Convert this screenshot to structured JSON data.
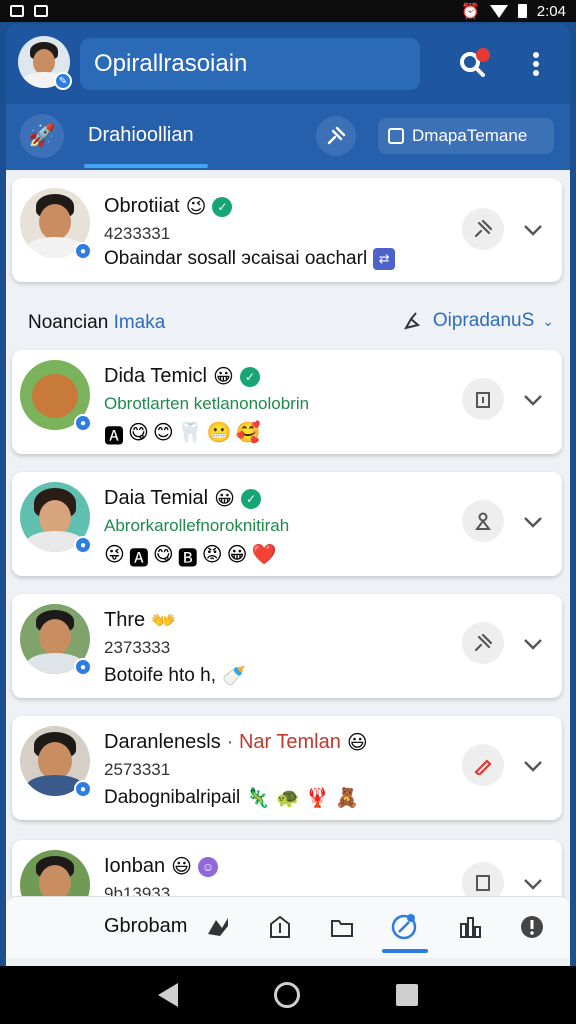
{
  "status_bar": {
    "time": "2:04"
  },
  "header": {
    "title": "Opirallrasoiain",
    "icons": [
      "search-icon",
      "more-vertical-icon"
    ]
  },
  "tabs": {
    "active_label": "Drahioollian",
    "pill_label": "DmapaTemane"
  },
  "section": {
    "title_part1": "Noancian",
    "title_part2": "Imaka",
    "sort_label": "OipradanuS"
  },
  "cards": [
    {
      "name": "Obrotiiat",
      "sub": "4233331",
      "msg": "Obaindar sosall эcaisai oacharl",
      "emoji": "😉",
      "emojis": []
    },
    {
      "name": "Dida Temicl",
      "sub": "Obrotlarten ketlanonolobrin",
      "msg": "",
      "emoji": "😀",
      "emojis": [
        "🅰",
        "😋",
        "😊",
        "🦷",
        "😬",
        "🥰"
      ]
    },
    {
      "name": "Daia Temial",
      "sub": "Abrorkarollefnoroknitirah",
      "msg": "",
      "emoji": "😀",
      "emojis": [
        "😜",
        "🅰",
        "😋",
        "🅱",
        "😡",
        "😀",
        "❤️"
      ]
    },
    {
      "name": "Thre",
      "sub": "2373333",
      "msg": "Botoife hto h,",
      "emoji": "👐",
      "emojis": []
    },
    {
      "name": "Daranlenesls",
      "name_accent": "· Nar Temlan",
      "sub": "2573331",
      "msg": "Dabognibalripail",
      "emoji": "😃",
      "emojis": [
        "🦎",
        "🐢",
        "🦞",
        "🧸"
      ]
    },
    {
      "name": "Ionban",
      "sub": "9b13933",
      "msg": "",
      "emoji": "😃",
      "emojis": []
    }
  ],
  "bottom_bar": {
    "label": "Gbrobam"
  }
}
